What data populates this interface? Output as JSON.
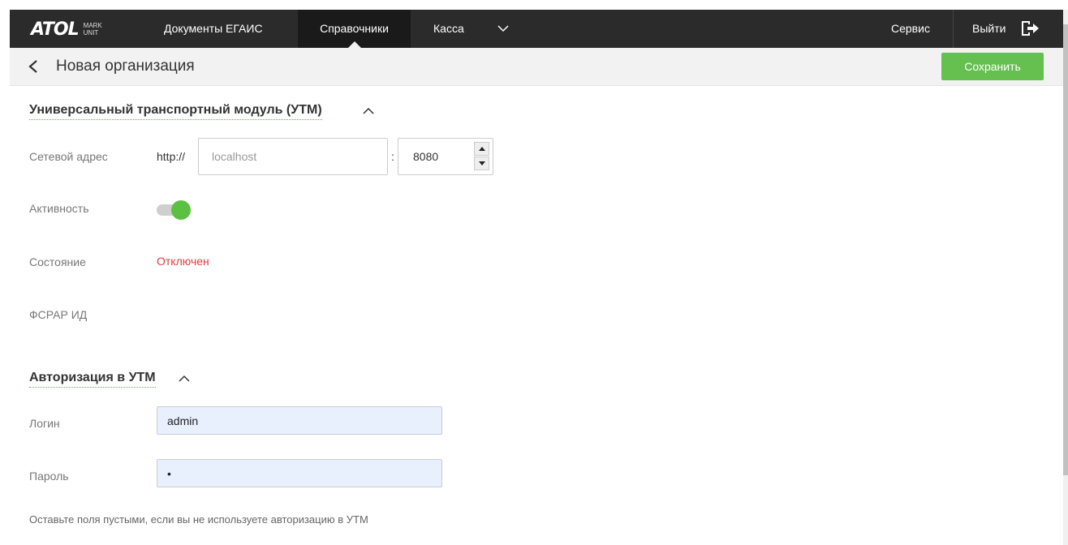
{
  "header": {
    "logo_text": "ATOL",
    "logo_sub_top": "MARK",
    "logo_sub_bottom": "UNIT",
    "nav": {
      "documents": "Документы ЕГАИС",
      "directories": "Справочники",
      "kassa": "Касса",
      "service": "Сервис",
      "logout": "Выйти"
    },
    "icons": {
      "menu_expand": "chevron-down-icon",
      "logout": "logout-arrow-icon"
    }
  },
  "titlebar": {
    "back_icon": "chevron-left-icon",
    "title": "Новая организация",
    "save_label": "Сохранить",
    "save_color": "#65c04f"
  },
  "utm_section": {
    "title": "Универсальный транспортный модуль (УТМ)",
    "collapse_icon": "chevron-up-icon",
    "address_label": "Сетевой адрес",
    "address_prefix": "http://",
    "host_placeholder": "localhost",
    "host_value": "",
    "port_separator": ":",
    "port_value": "8080",
    "activity_label": "Активность",
    "activity_on": true,
    "state_label": "Состояние",
    "state_value": "Отключен",
    "state_color": "#e5393a",
    "fsrar_label": "ФСРАР ИД",
    "fsrar_value": ""
  },
  "auth_section": {
    "title": "Авторизация в УТМ",
    "collapse_icon": "chevron-up-icon",
    "login_label": "Логин",
    "login_value": "admin",
    "password_label": "Пароль",
    "password_value": "•",
    "hint": "Оставьте поля пустыми, если вы не используете авторизацию в УТМ"
  }
}
